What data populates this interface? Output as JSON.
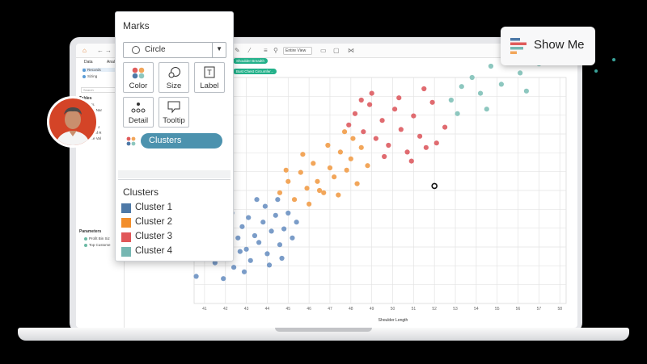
{
  "toolbar": {
    "fit_select": "Entire View"
  },
  "data_pane": {
    "tabs": [
      "Data",
      "Anal"
    ],
    "sources": [
      "Records",
      "Sizing"
    ],
    "search_placeholder": "Search",
    "tables_header": "Tables",
    "fields": [
      "Clusters",
      "Measure Nar",
      "st Chest C",
      "oulder Bre",
      "lgnated Dat",
      "Number of R",
      "Measure Val"
    ],
    "parameters_header": "Parameters",
    "parameters": [
      "Profit Bin Siz",
      "Top Custome"
    ]
  },
  "shelves": {
    "row_pill": "Shoulder Breadth",
    "color_pill": "Bust Chest Circumfer..."
  },
  "marks": {
    "title": "Marks",
    "mark_type": "Circle",
    "buttons": {
      "color": "Color",
      "size": "Size",
      "label": "Label",
      "detail": "Detail",
      "tooltip": "Tooltip"
    },
    "color_field": "Clusters"
  },
  "legend": {
    "title": "Clusters",
    "items": [
      {
        "label": "Cluster 1",
        "color": "#4e79a7"
      },
      {
        "label": "Cluster 2",
        "color": "#f28e2b"
      },
      {
        "label": "Cluster 3",
        "color": "#e15759"
      },
      {
        "label": "Cluster 4",
        "color": "#76b7b2"
      }
    ]
  },
  "show_me": {
    "label": "Show Me"
  },
  "chart_data": {
    "type": "scatter",
    "xlabel": "Shoulder Length",
    "ylabel": "",
    "x_ticks": [
      41,
      42,
      43,
      44,
      45,
      46,
      47,
      48,
      49,
      50,
      51,
      52,
      53,
      54,
      55,
      56,
      57,
      58
    ],
    "xlim": [
      40.5,
      58.3
    ],
    "ylim": [
      0,
      10
    ],
    "series": [
      {
        "name": "Cluster 1",
        "color": "#7a9cc8",
        "points": [
          [
            40.6,
            1.2
          ],
          [
            40.9,
            2.5
          ],
          [
            41.2,
            2.1
          ],
          [
            41.5,
            1.8
          ],
          [
            41.8,
            2.6
          ],
          [
            42.0,
            3.1
          ],
          [
            42.2,
            2.0
          ],
          [
            42.4,
            1.6
          ],
          [
            42.6,
            2.9
          ],
          [
            42.8,
            3.4
          ],
          [
            43.0,
            2.4
          ],
          [
            43.2,
            1.9
          ],
          [
            43.4,
            3.0
          ],
          [
            43.6,
            2.7
          ],
          [
            43.8,
            3.6
          ],
          [
            44.0,
            2.2
          ],
          [
            44.2,
            3.2
          ],
          [
            44.4,
            3.9
          ],
          [
            44.6,
            2.6
          ],
          [
            44.8,
            3.3
          ],
          [
            45.0,
            4.0
          ],
          [
            45.2,
            2.9
          ],
          [
            42.9,
            1.4
          ],
          [
            41.6,
            3.3
          ],
          [
            43.9,
            4.3
          ],
          [
            42.3,
            4.0
          ],
          [
            44.5,
            4.6
          ],
          [
            43.1,
            3.8
          ],
          [
            41.9,
            1.1
          ],
          [
            44.1,
            1.7
          ],
          [
            45.4,
            3.6
          ],
          [
            42.7,
            2.3
          ],
          [
            43.5,
            4.6
          ],
          [
            40.8,
            3.1
          ],
          [
            44.7,
            2.0
          ]
        ]
      },
      {
        "name": "Cluster 2",
        "color": "#f2a65a",
        "points": [
          [
            44.6,
            4.9
          ],
          [
            45.0,
            5.4
          ],
          [
            45.3,
            4.6
          ],
          [
            45.6,
            5.8
          ],
          [
            45.9,
            5.1
          ],
          [
            46.2,
            6.2
          ],
          [
            46.4,
            5.4
          ],
          [
            46.7,
            4.9
          ],
          [
            47.0,
            6.0
          ],
          [
            47.2,
            5.6
          ],
          [
            47.5,
            6.7
          ],
          [
            47.8,
            5.9
          ],
          [
            48.0,
            6.4
          ],
          [
            48.3,
            5.3
          ],
          [
            48.5,
            6.9
          ],
          [
            48.8,
            6.1
          ],
          [
            46.0,
            4.4
          ],
          [
            47.4,
            4.8
          ],
          [
            45.7,
            6.6
          ],
          [
            46.9,
            7.0
          ],
          [
            48.1,
            7.3
          ],
          [
            44.9,
            5.9
          ],
          [
            47.7,
            7.6
          ],
          [
            46.5,
            5.0
          ]
        ]
      },
      {
        "name": "Cluster 3",
        "color": "#e06b70",
        "points": [
          [
            47.9,
            7.9
          ],
          [
            48.2,
            8.4
          ],
          [
            48.6,
            7.6
          ],
          [
            48.9,
            8.8
          ],
          [
            49.2,
            7.3
          ],
          [
            49.5,
            8.1
          ],
          [
            49.8,
            7.0
          ],
          [
            50.1,
            8.6
          ],
          [
            50.4,
            7.7
          ],
          [
            50.7,
            6.7
          ],
          [
            51.0,
            8.3
          ],
          [
            51.3,
            7.4
          ],
          [
            51.6,
            6.9
          ],
          [
            51.9,
            8.9
          ],
          [
            52.1,
            7.1
          ],
          [
            49.0,
            9.3
          ],
          [
            50.3,
            9.1
          ],
          [
            48.5,
            9.0
          ],
          [
            51.5,
            9.5
          ],
          [
            50.9,
            6.3
          ],
          [
            52.5,
            7.8
          ],
          [
            49.6,
            6.5
          ]
        ]
      },
      {
        "name": "Cluster 4",
        "color": "#8dc7bf",
        "points": [
          [
            52.8,
            9.0
          ],
          [
            53.3,
            9.6
          ],
          [
            53.8,
            10.0
          ],
          [
            54.2,
            9.3
          ],
          [
            54.7,
            10.5
          ],
          [
            55.2,
            9.7
          ],
          [
            55.6,
            10.9
          ],
          [
            56.1,
            10.2
          ],
          [
            56.6,
            11.3
          ],
          [
            57.0,
            10.6
          ],
          [
            57.5,
            11.7
          ],
          [
            58.0,
            11.0
          ],
          [
            54.5,
            8.6
          ],
          [
            56.4,
            9.4
          ],
          [
            57.8,
            12.2
          ],
          [
            53.1,
            8.4
          ],
          [
            55.9,
            11.8
          ],
          [
            58.6,
            12.6
          ]
        ]
      }
    ],
    "highlighted_point": [
      52.0,
      5.2
    ]
  }
}
